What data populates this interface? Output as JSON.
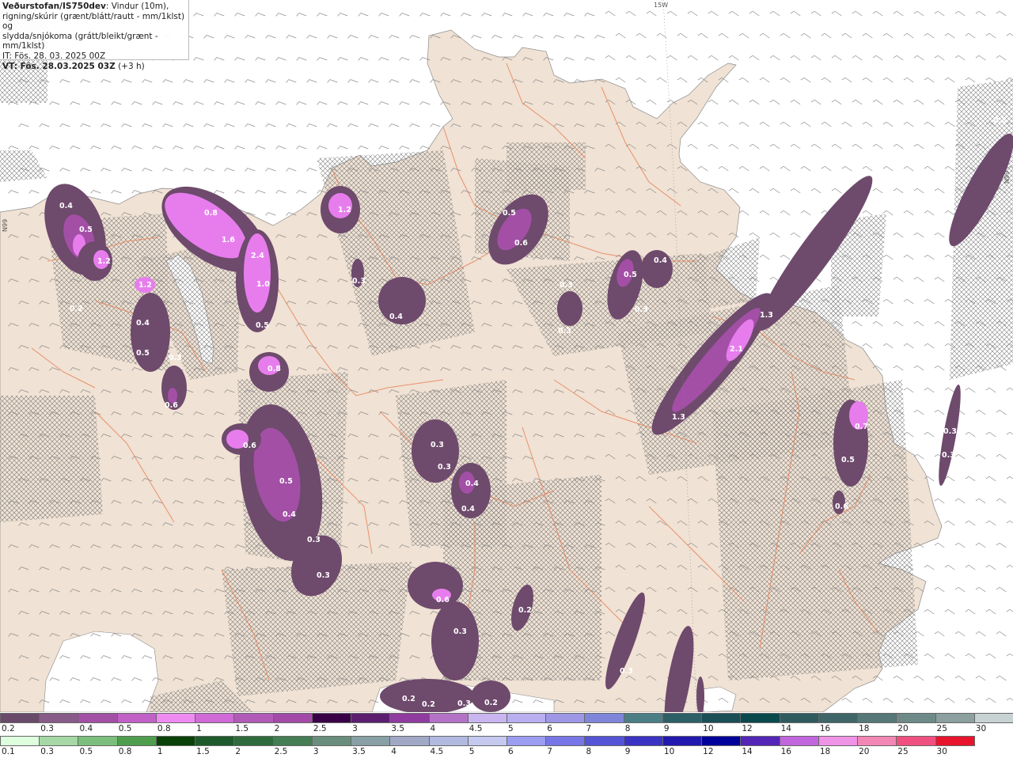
{
  "header": {
    "title": "Veðurstofan/IS750dev",
    "desc_line1": ": Vindur (10m),",
    "desc_line2": "rigning/skúrir (grænt/blátt/rautt - mm/1klst) og",
    "desc_line3": "slydda/snjókoma (grátt/bleikt/grænt - mm/1klst)",
    "it_line": "IT: Fös. 28. 03. 2025 00Z",
    "vt_bold": "VT: Fös. 28.03.2025 03Z",
    "vt_suffix": " (+3 h)"
  },
  "grid_labels": {
    "top": "15W",
    "left": "N99",
    "right": "N99"
  },
  "colors": {
    "land": "#f0e2d4",
    "sea": "#ffffff",
    "road": "#e8835a",
    "precip_light": "#6e4a6c",
    "precip_mid": "#a34fa6",
    "precip_heavy": "#e77ded"
  },
  "precip_labels": [
    "0.4",
    "0.5",
    "1.2",
    "0.2",
    "1.2",
    "0.4",
    "0.5",
    "0.3",
    "0.6",
    "0.8",
    "1.6",
    "2.4",
    "1.0",
    "0.5",
    "0.8",
    "0.6",
    "0.5",
    "0.4",
    "0.3",
    "0.3",
    "1.2",
    "0.3",
    "0.4",
    "0.5",
    "0.6",
    "0.3",
    "0.3",
    "0.4",
    "0.4",
    "0.6",
    "0.3",
    "0.2",
    "0.2",
    "0.2",
    "0.3",
    "0.2",
    "0.3",
    "0.5",
    "0.3",
    "0.4",
    "1.3",
    "2.1",
    "1.3",
    "0.3",
    "0.7",
    "0.5",
    "0.6",
    "0.3",
    "0.3",
    "0.3",
    "0.3",
    "0.3"
  ],
  "legend_sleet": {
    "values": [
      "0.2",
      "0.3",
      "0.4",
      "0.5",
      "0.8",
      "1",
      "1.5",
      "2",
      "2.5",
      "3",
      "3.5",
      "4",
      "4.5",
      "5",
      "6",
      "7",
      "8",
      "9",
      "10",
      "12",
      "14",
      "16",
      "18",
      "20",
      "25",
      "30"
    ],
    "colors": [
      "#6a4a6a",
      "#885b88",
      "#a34fa6",
      "#c160c6",
      "#f08af3",
      "#cf6ad6",
      "#b25ab8",
      "#a34aa9",
      "#3a0047",
      "#5c1f70",
      "#8f3ba0",
      "#b472c6",
      "#c9b5f0",
      "#b9aef0",
      "#9d97e6",
      "#7f86d9",
      "#4b7f85",
      "#2d5f66",
      "#1a4f55",
      "#0b4a4c",
      "#2f5b5e",
      "#3f6668",
      "#567876",
      "#6d8a88",
      "#8ba09f",
      "#c7d2d2"
    ]
  },
  "legend_rain": {
    "values": [
      "0.1",
      "0.3",
      "0.5",
      "0.8",
      "1",
      "1.5",
      "2",
      "2.5",
      "3",
      "3.5",
      "4",
      "4.5",
      "5",
      "6",
      "7",
      "8",
      "9",
      "10",
      "12",
      "14",
      "16",
      "18",
      "20",
      "25",
      "30"
    ],
    "colors": [
      "#ddffdd",
      "#a5d8a5",
      "#7cbf7c",
      "#4e9e4e",
      "#094209",
      "#1e5a2b",
      "#2f6b3c",
      "#457d55",
      "#6a8e7d",
      "#879fa5",
      "#a0a8c6",
      "#b1b9e0",
      "#c5c9ef",
      "#9b9df1",
      "#7876e6",
      "#5554d6",
      "#3a33c4",
      "#2219b0",
      "#00009a",
      "#5326b8",
      "#c266de",
      "#ee93e6",
      "#f286b4",
      "#f05080",
      "#e8142c"
    ]
  }
}
